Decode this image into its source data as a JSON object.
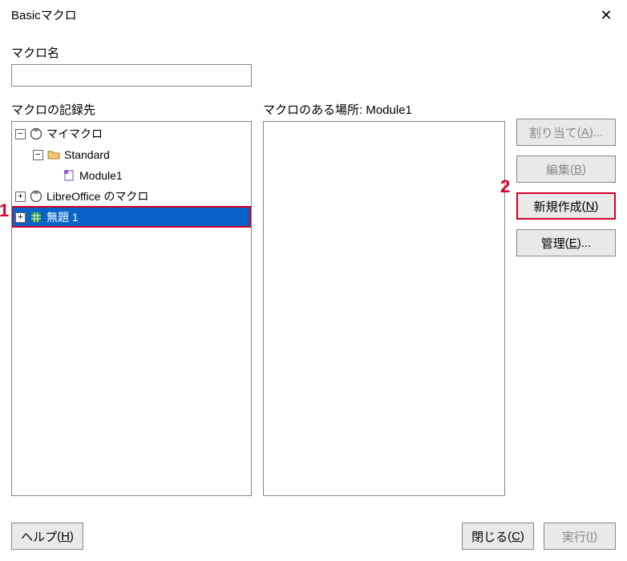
{
  "title": "Basicマクロ",
  "labels": {
    "macro_name": "マクロ名",
    "record_to": "マクロの記録先",
    "macro_location_prefix": "マクロのある場所: ",
    "macro_location_module": "Module1"
  },
  "tree": {
    "my_macros": "マイマクロ",
    "standard": "Standard",
    "module1": "Module1",
    "libreoffice_macros": "LibreOffice のマクロ",
    "untitled1": "無題 1"
  },
  "buttons": {
    "assign": "割り当て",
    "assign_key": "A",
    "edit": "編集",
    "edit_key": "B",
    "new": "新規作成",
    "new_key": "N",
    "manage": "管理",
    "manage_key": "E",
    "help": "ヘルプ",
    "help_key": "H",
    "close": "閉じる",
    "close_key": "C",
    "run": "実行",
    "run_key": "I"
  },
  "macro_name_value": "",
  "annotations": {
    "one": "1",
    "two": "2"
  }
}
